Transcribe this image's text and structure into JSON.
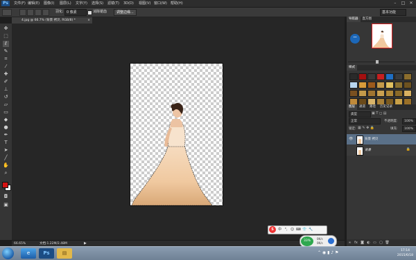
{
  "app": {
    "logo": "Ps"
  },
  "menu": [
    "文件(F)",
    "编辑(E)",
    "图像(I)",
    "图层(L)",
    "文字(Y)",
    "选择(S)",
    "滤镜(T)",
    "3D(D)",
    "视图(V)",
    "窗口(W)",
    "帮助(H)"
  ],
  "window_controls": [
    "–",
    "□",
    "✕"
  ],
  "options_bar": {
    "feather_label": "羽化:",
    "feather_value": "0 像素",
    "antialias_label": "消除锯齿",
    "refine_edge": "调整边缘...",
    "workspace": "基本功能"
  },
  "document_tab": {
    "title": "4.jpg @ 66.7% (背景 拷贝, RGB/8) *",
    "close": "×"
  },
  "status_bar": {
    "zoom": "66.65%",
    "doc_size": "文档:1.22M/2.48M"
  },
  "navigator": {
    "tab": "导航器",
    "extra_tab": "直方图"
  },
  "styles_panel": {
    "tab": "样式"
  },
  "layers_panel": {
    "tabs": [
      "图层",
      "通道",
      "路径",
      "历史记录"
    ],
    "kind_filter": "类型",
    "blend_mode": "正常",
    "opacity_label": "不透明度:",
    "opacity_value": "100%",
    "lock_label": "锁定:",
    "fill_label": "填充:",
    "fill_value": "100%",
    "layers": [
      {
        "name": "背景 拷贝",
        "visible": true,
        "selected": true
      },
      {
        "name": "背景",
        "visible": false,
        "selected": false,
        "locked": true
      }
    ]
  },
  "taskbar": {
    "time": "17:14",
    "date": "2015/6/18"
  },
  "ime_bar": {
    "logo": "S",
    "items": [
      "中",
      "°,",
      "☺",
      "⌨",
      "👕",
      "🔧"
    ]
  },
  "net_widget": {
    "percent": "33%",
    "up": "0K/s",
    "down": "0K/s"
  },
  "colors": {
    "foreground": "#d41313",
    "background": "#ffffff",
    "accent": "#1b4c84"
  }
}
